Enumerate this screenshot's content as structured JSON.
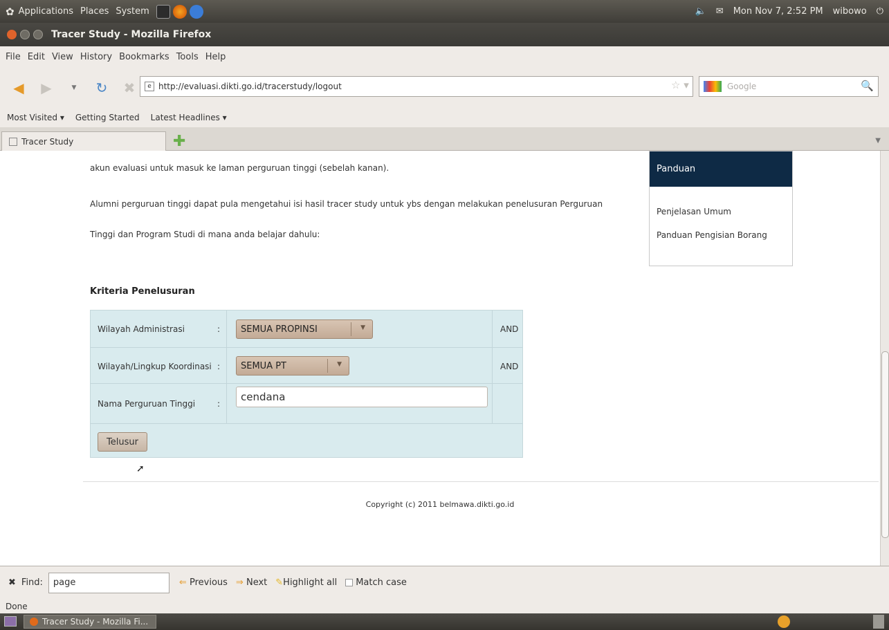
{
  "panel": {
    "menus": [
      "Applications",
      "Places",
      "System"
    ],
    "datetime": "Mon Nov 7, 2:52 PM",
    "user": "wibowo"
  },
  "window": {
    "title": "Tracer Study - Mozilla Firefox"
  },
  "menubar": [
    "File",
    "Edit",
    "View",
    "History",
    "Bookmarks",
    "Tools",
    "Help"
  ],
  "nav": {
    "url": "http://evaluasi.dikti.go.id/tracerstudy/logout",
    "search_placeholder": "Google"
  },
  "bookmarks": [
    "Most Visited ▾",
    "Getting Started",
    "Latest Headlines ▾"
  ],
  "tab": {
    "label": "Tracer Study"
  },
  "page": {
    "intro_line": "akun evaluasi untuk masuk ke laman perguruan tinggi (sebelah kanan).",
    "para_line1": "Alumni perguruan tinggi dapat pula mengetahui isi hasil tracer study untuk ybs dengan melakukan penelusuran Perguruan",
    "para_line2": "Tinggi dan Program Studi di mana anda belajar dahulu:",
    "criteria_heading": "Kriteria Penelusuran",
    "sidebar": {
      "heading": "Panduan",
      "links": [
        "Penjelasan Umum",
        "Panduan Pengisian Borang"
      ]
    },
    "form": {
      "rows": [
        {
          "label": "Wilayah Administrasi",
          "value": "SEMUA PROPINSI",
          "op": "AND"
        },
        {
          "label": "Wilayah/Lingkup Koordinasi",
          "value": "SEMUA PT",
          "op": "AND"
        },
        {
          "label": "Nama Perguruan Tinggi",
          "value": "cendana"
        }
      ],
      "submit_label": "Telusur"
    },
    "copyright": "Copyright (c) 2011 belmawa.dikti.go.id"
  },
  "findbar": {
    "label": "Find:",
    "value": "page",
    "previous": "Previous",
    "next": "Next",
    "highlight": "Highlight all",
    "match_case": "Match case"
  },
  "status": "Done",
  "taskbar": {
    "window_button": "Tracer Study - Mozilla Fi..."
  }
}
